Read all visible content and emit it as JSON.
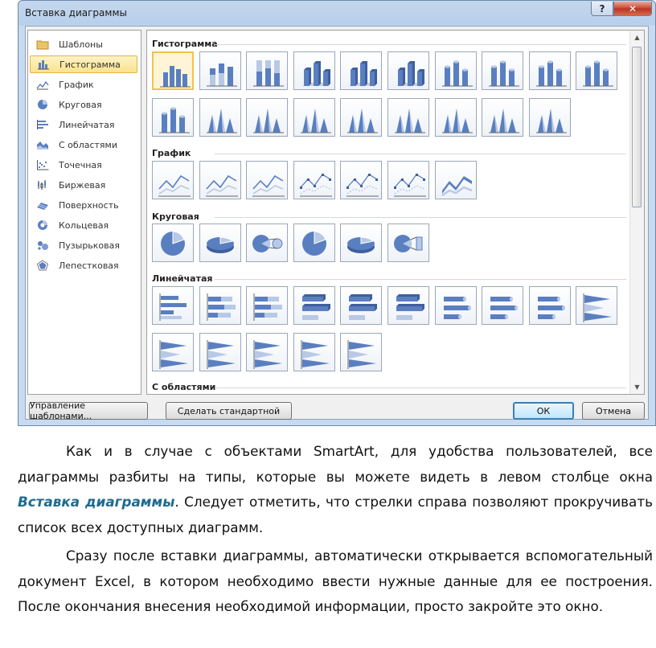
{
  "dialog": {
    "title": "Вставка диаграммы",
    "help_label": "?",
    "close_label": "✕"
  },
  "type_list": [
    {
      "label": "Шаблоны",
      "icon": "folder-icon"
    },
    {
      "label": "Гистограмма",
      "icon": "column-chart-icon",
      "selected": true
    },
    {
      "label": "График",
      "icon": "line-chart-icon"
    },
    {
      "label": "Круговая",
      "icon": "pie-chart-icon"
    },
    {
      "label": "Линейчатая",
      "icon": "bar-chart-icon"
    },
    {
      "label": "С областями",
      "icon": "area-chart-icon"
    },
    {
      "label": "Точечная",
      "icon": "scatter-chart-icon"
    },
    {
      "label": "Биржевая",
      "icon": "stock-chart-icon"
    },
    {
      "label": "Поверхность",
      "icon": "surface-chart-icon"
    },
    {
      "label": "Кольцевая",
      "icon": "doughnut-chart-icon"
    },
    {
      "label": "Пузырьковая",
      "icon": "bubble-chart-icon"
    },
    {
      "label": "Лепестковая",
      "icon": "radar-chart-icon"
    }
  ],
  "gallery": {
    "sections": [
      "Гистограмма",
      "График",
      "Круговая",
      "Линейчатая",
      "С областями"
    ]
  },
  "buttons": {
    "manage_templates": "Управление шаблонами...",
    "set_default": "Сделать стандартной",
    "ok": "ОК",
    "cancel": "Отмена"
  },
  "text": {
    "p1_before": "Как и в случае с объектами SmartArt, для удобства пользователей, все диаграммы разбиты на типы, которые вы можете видеть в левом столбце окна ",
    "p1_em": "Вставка диаграммы",
    "p1_after": ". Следует отметить, что стрелки справа позволяют прокручивать список всех доступных диаграмм.",
    "p2": "Сразу после вставки диаграммы, автоматически открывается вспомогательный документ Excel, в котором необходимо ввести нужные данные для ее построения. После окончания внесения необходимой информации, просто закройте это окно."
  },
  "colors": {
    "chart_blue": "#5a7fc0",
    "chart_light": "#b7c9e6",
    "selection_gold": "#f2c24a",
    "emphasis": "#1f6b8f"
  }
}
